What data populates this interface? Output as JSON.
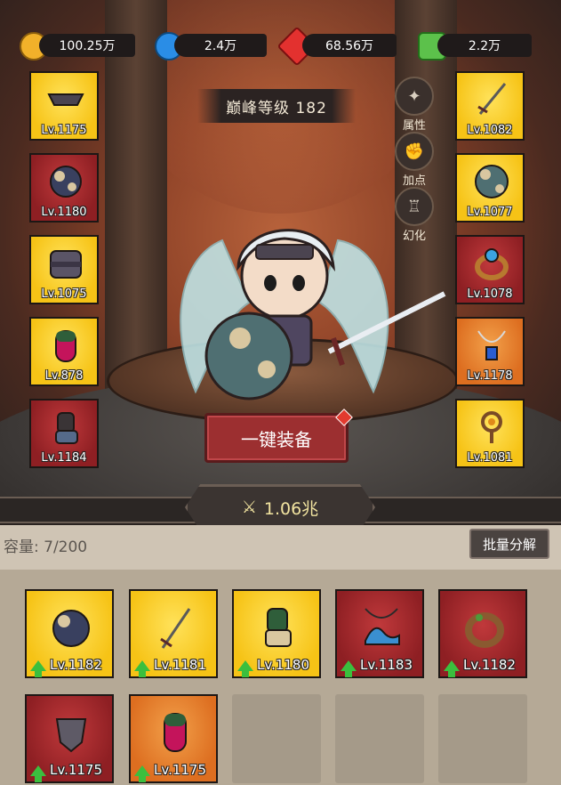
{
  "resources": [
    {
      "icon": "gold-coin-icon",
      "value": "100.25万",
      "color": "#f2b12a"
    },
    {
      "icon": "blue-orb-icon",
      "value": "2.4万",
      "color": "#2a8de6"
    },
    {
      "icon": "red-gem-icon",
      "value": "68.56万",
      "color": "#e3312f"
    },
    {
      "icon": "green-cash-icon",
      "value": "2.2万",
      "color": "#5cc14b"
    }
  ],
  "peak_level": "巅峰等级 182",
  "side_menu": [
    {
      "icon": "attribute-icon",
      "label": "属性"
    },
    {
      "icon": "fist-icon",
      "label": "加点"
    },
    {
      "icon": "outfit-icon",
      "label": "幻化"
    }
  ],
  "left_slots": [
    {
      "rarity": "yellow",
      "item": "helmet-visor",
      "level": "Lv.1175"
    },
    {
      "rarity": "red",
      "item": "shoulder-armor",
      "level": "Lv.1180"
    },
    {
      "rarity": "yellow",
      "item": "chest-armor",
      "level": "Lv.1075"
    },
    {
      "rarity": "yellow",
      "item": "glove",
      "level": "Lv.878"
    },
    {
      "rarity": "red",
      "item": "boots",
      "level": "Lv.1184"
    }
  ],
  "right_slots": [
    {
      "rarity": "yellow",
      "item": "sword",
      "level": "Lv.1082"
    },
    {
      "rarity": "yellow",
      "item": "shield",
      "level": "Lv.1077"
    },
    {
      "rarity": "red",
      "item": "ring",
      "level": "Lv.1078"
    },
    {
      "rarity": "orange",
      "item": "necklace",
      "level": "Lv.1178"
    },
    {
      "rarity": "yellow",
      "item": "amulet",
      "level": "Lv.1081"
    }
  ],
  "equip_button": "一键装备",
  "combat_power": "1.06兆",
  "bag": {
    "capacity": "容量: 7/200",
    "decompose_button": "批量分解",
    "items": [
      {
        "rarity": "yellow",
        "item": "shoulder-armor",
        "level": "Lv.1182"
      },
      {
        "rarity": "yellow",
        "item": "sword",
        "level": "Lv.1181"
      },
      {
        "rarity": "yellow",
        "item": "boots",
        "level": "Lv.1180"
      },
      {
        "rarity": "red",
        "item": "wave-necklace",
        "level": "Lv.1183"
      },
      {
        "rarity": "red",
        "item": "vine-ring",
        "level": "Lv.1182"
      },
      {
        "rarity": "red",
        "item": "shield",
        "level": "Lv.1175"
      },
      {
        "rarity": "orange",
        "item": "glove",
        "level": "Lv.1175"
      }
    ]
  }
}
